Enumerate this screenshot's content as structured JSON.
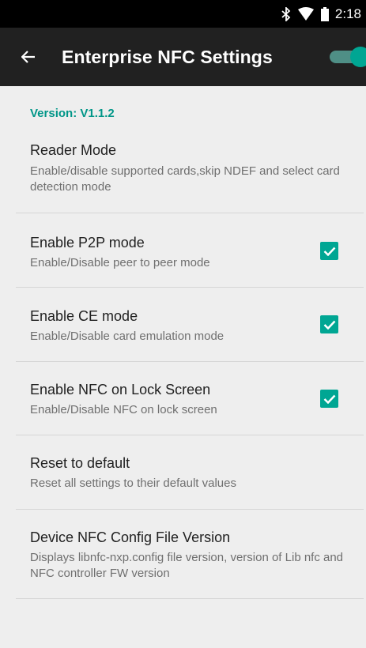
{
  "status_bar": {
    "time": "2:18",
    "icons": [
      "bluetooth-icon",
      "wifi-icon",
      "battery-icon"
    ]
  },
  "app_bar": {
    "title": "Enterprise NFC Settings",
    "back_icon": "arrow-back-icon",
    "master_switch_on": true
  },
  "version": "Version: V1.1.2",
  "preferences": [
    {
      "title": "Reader Mode",
      "summary": "Enable/disable supported cards,skip NDEF and select card detection mode"
    },
    {
      "title": "Enable P2P mode",
      "summary": "Enable/Disable peer to peer mode",
      "checked": true
    },
    {
      "title": "Enable CE mode",
      "summary": "Enable/Disable card emulation mode",
      "checked": true
    },
    {
      "title": "Enable NFC on Lock Screen",
      "summary": "Enable/Disable NFC on lock screen",
      "checked": true
    },
    {
      "title": "Reset to default",
      "summary": "Reset all settings to their default values"
    },
    {
      "title": "Device NFC Config File Version",
      "summary": "Displays libnfc-nxp.config file version, version of Lib nfc and NFC controller FW version"
    }
  ],
  "colors": {
    "accent": "#00a693",
    "app_bar": "#212121",
    "background": "#eeeeee"
  }
}
